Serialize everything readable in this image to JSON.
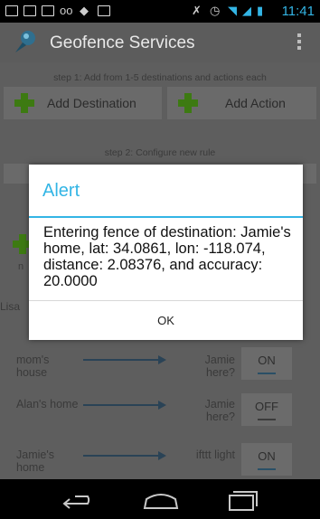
{
  "status": {
    "time": "11:41"
  },
  "app": {
    "title": "Geofence Services"
  },
  "step1": {
    "text": "step 1: Add from 1-5 destinations and actions each"
  },
  "buttons": {
    "add_destination": "Add Destination",
    "add_action": "Add Action"
  },
  "step2": {
    "text": "step 2: Configure new rule"
  },
  "partial": {
    "n": "n",
    "lisa": "Lisa"
  },
  "rules": [
    {
      "destination": "mom's house",
      "action": "Jamie here?",
      "toggle": "ON"
    },
    {
      "destination": "Alan's home",
      "action": "Jamie here?",
      "toggle": "OFF"
    },
    {
      "destination": "Jamie's home",
      "action": "ifttt light",
      "toggle": "ON"
    }
  ],
  "dialog": {
    "title": "Alert",
    "message": "Entering fence of destination: Jamie's home, lat: 34.0861, lon: -118.074, distance: 2.08376, and accuracy: 20.0000",
    "ok": "OK"
  },
  "colors": {
    "accent": "#33b5e5",
    "plus_green": "#3d7a12"
  }
}
